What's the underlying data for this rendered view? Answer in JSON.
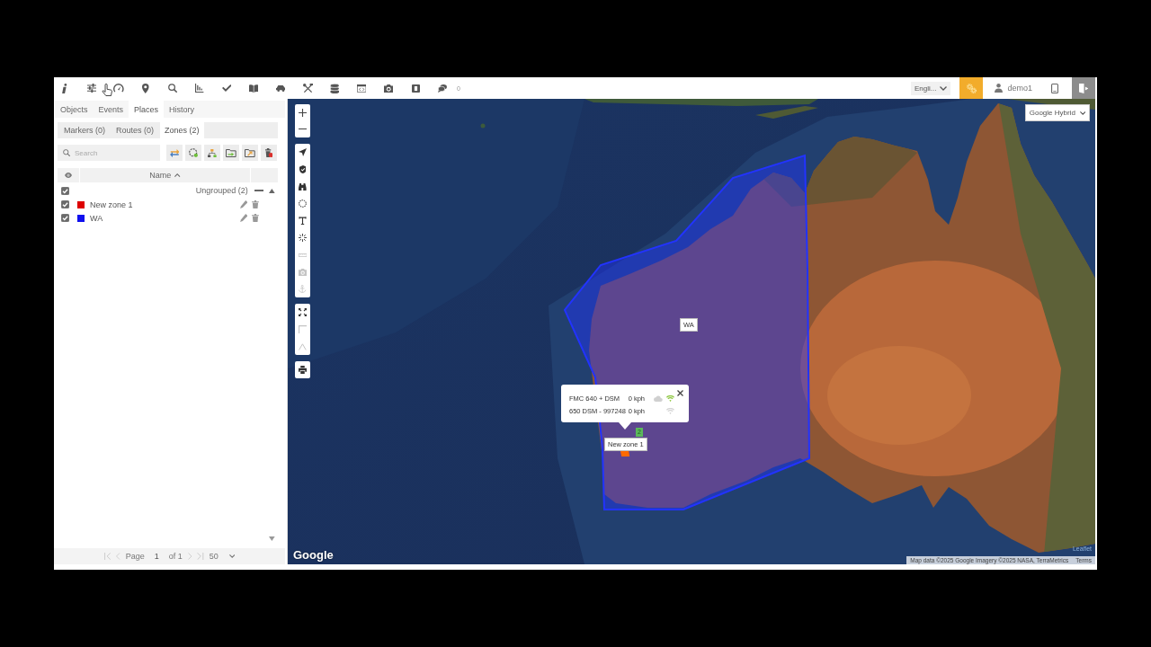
{
  "top_bar": {
    "message_count": "0",
    "language": "Engli...",
    "user": "demo1"
  },
  "panel": {
    "tabs": [
      {
        "label": "Objects",
        "selected": false
      },
      {
        "label": "Events",
        "selected": false
      },
      {
        "label": "Places",
        "selected": true
      },
      {
        "label": "History",
        "selected": false
      }
    ],
    "subtabs": [
      {
        "label": "Markers (0)",
        "selected": false
      },
      {
        "label": "Routes (0)",
        "selected": false
      },
      {
        "label": "Zones (2)",
        "selected": true
      }
    ],
    "search": {
      "placeholder": "Search"
    },
    "header": {
      "column": "Name",
      "sorted_ascending": true
    },
    "groups": [
      {
        "label": "Ungrouped (2)",
        "checked": true,
        "expanded": true,
        "zones": [
          {
            "name": "New zone 1",
            "color": "#dd0000",
            "checked": true
          },
          {
            "name": "WA",
            "color": "#1010ee",
            "checked": true
          }
        ]
      }
    ],
    "pagination": {
      "back": [
        {
          "disabled": true
        },
        {
          "disabled": true
        }
      ],
      "label": "Page",
      "page": "1",
      "total": "of 1",
      "forward": [
        {
          "disabled": true
        },
        {
          "disabled": true
        }
      ],
      "per_page": "50"
    }
  },
  "map": {
    "layer": "Google Hybrid",
    "toolbars": [
      {
        "buttons": [
          {
            "disabled": false
          },
          {
            "disabled": false
          },
          {
            "disabled": false
          },
          {
            "disabled": false
          },
          {
            "disabled": false
          },
          {
            "disabled": false
          },
          {
            "disabled": true
          },
          {
            "disabled": true
          },
          {
            "disabled": true
          }
        ]
      },
      {
        "buttons": [
          {
            "disabled": false
          },
          {
            "disabled": true
          },
          {
            "disabled": true
          }
        ]
      },
      {
        "buttons": [
          {
            "disabled": false
          }
        ]
      }
    ],
    "zones": [
      {
        "label": "WA",
        "color": "#2233ff"
      },
      {
        "label": "New zone 1",
        "color": "#ff6a00"
      }
    ],
    "popup": {
      "rows": [
        {
          "name": "FMC 640 + DSM",
          "speed": "0 kph",
          "cloud": true,
          "online": true
        },
        {
          "name": "650 DSM - 997248",
          "speed": "0 kph",
          "cloud": false,
          "online": false
        }
      ]
    },
    "cluster": "2",
    "logo": "Google",
    "attribution": "Map data ©2025 Google Imagery ©2025 NASA, TerraMetrics",
    "terms": "Terms",
    "credit": "Leaflet"
  }
}
